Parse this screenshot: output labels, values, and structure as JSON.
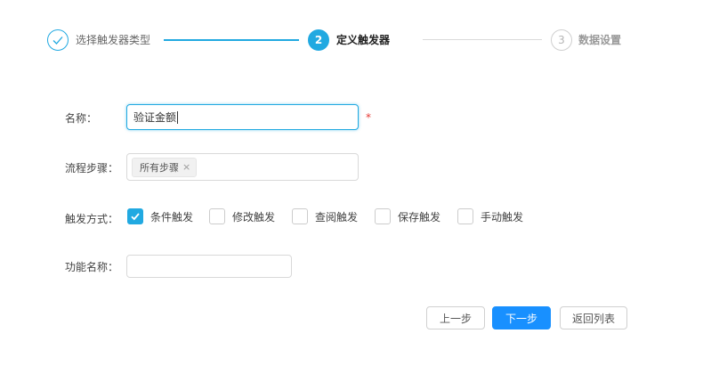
{
  "steps": [
    {
      "number": "✓",
      "label": "选择触发器类型",
      "state": "done"
    },
    {
      "number": "2",
      "label": "定义触发器",
      "state": "active"
    },
    {
      "number": "3",
      "label": "数据设置",
      "state": "pending"
    }
  ],
  "form": {
    "name_label": "名称：",
    "name_value": "验证金额",
    "required_mark": "*",
    "flow_label": "流程步骤：",
    "flow_tag": "所有步骤",
    "flow_tag_close": "×",
    "trigger_label": "触发方式：",
    "trigger_options": [
      {
        "label": "条件触发",
        "checked": true
      },
      {
        "label": "修改触发",
        "checked": false
      },
      {
        "label": "查阅触发",
        "checked": false
      },
      {
        "label": "保存触发",
        "checked": false
      },
      {
        "label": "手动触发",
        "checked": false
      }
    ],
    "func_label": "功能名称：",
    "func_value": ""
  },
  "buttons": {
    "prev": "上一步",
    "next": "下一步",
    "back": "返回列表"
  },
  "colors": {
    "accent": "#21a9e1",
    "primary_button": "#1890ff",
    "required": "#e53935"
  }
}
